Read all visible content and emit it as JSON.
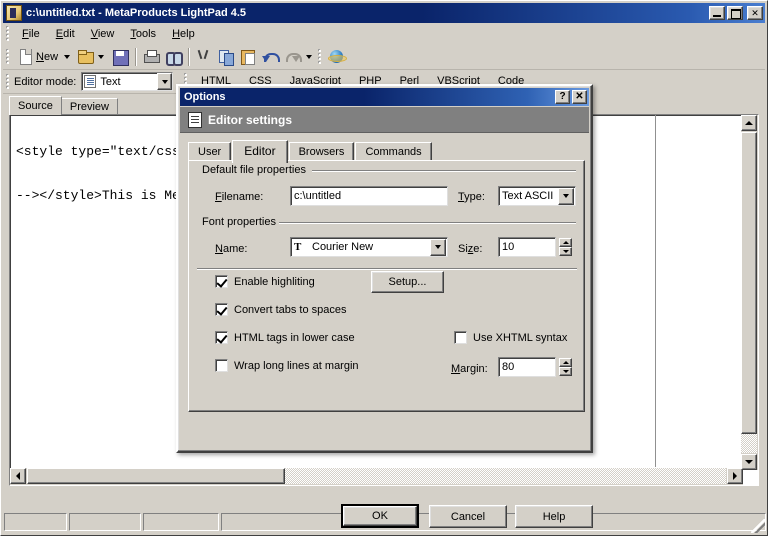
{
  "window": {
    "title": "c:\\untitled.txt - MetaProducts LightPad 4.5",
    "icon": "app-icon",
    "minimize": "_",
    "maximize": "□",
    "close": "✕"
  },
  "menu": {
    "items": [
      {
        "label": "File",
        "accel": "F"
      },
      {
        "label": "Edit",
        "accel": "E"
      },
      {
        "label": "View",
        "accel": "V"
      },
      {
        "label": "Tools",
        "accel": "T"
      },
      {
        "label": "Help",
        "accel": "H"
      }
    ]
  },
  "toolbar": {
    "new_label": "New",
    "buttons": [
      {
        "name": "new-file-button",
        "icon": "new-document-icon"
      },
      {
        "name": "open-file-button",
        "icon": "open-folder-icon"
      },
      {
        "name": "save-file-button",
        "icon": "floppy-disk-icon"
      },
      {
        "name": "print-button",
        "icon": "printer-icon"
      },
      {
        "name": "find-button",
        "icon": "binoculars-icon"
      },
      {
        "name": "cut-button",
        "icon": "scissors-icon"
      },
      {
        "name": "copy-button",
        "icon": "copy-icon"
      },
      {
        "name": "paste-button",
        "icon": "clipboard-icon"
      },
      {
        "name": "undo-button",
        "icon": "undo-arrow-icon"
      },
      {
        "name": "redo-button",
        "icon": "redo-arrow-icon"
      },
      {
        "name": "browser-preview-button",
        "icon": "internet-explorer-icon"
      }
    ]
  },
  "mode_bar": {
    "label": "Editor mode:",
    "value": "Text"
  },
  "language_bar": {
    "items": [
      "HTML",
      "CSS",
      "JavaScript",
      "PHP",
      "Perl",
      "VBScript",
      "Code"
    ]
  },
  "editor": {
    "tabs": [
      {
        "label": "Source",
        "active": true
      },
      {
        "label": "Preview",
        "active": false
      }
    ],
    "content": "<style type=\"text/css\n\n--></style>This is Me"
  },
  "status_bar": {
    "cells": [
      "",
      "",
      "",
      ""
    ]
  },
  "dialog": {
    "title": "Options",
    "help_button": "?",
    "close_button": "✕",
    "header": {
      "icon": "notepad-icon",
      "text": "Editor settings"
    },
    "tabs": [
      {
        "label": "User",
        "active": false
      },
      {
        "label": "Editor",
        "active": true
      },
      {
        "label": "Browsers",
        "active": false
      },
      {
        "label": "Commands",
        "active": false
      }
    ],
    "groups": {
      "file_properties": {
        "title": "Default file properties",
        "filename_label": "Filename:",
        "filename_accel": "F",
        "filename_value": "c:\\untitled",
        "type_label": "Type:",
        "type_accel": "T",
        "type_value": "Text ASCII"
      },
      "font_properties": {
        "title": "Font properties",
        "name_label": "Name:",
        "name_accel": "N",
        "name_value": "Courier New",
        "name_icon": "truetype-icon",
        "size_label": "Size:",
        "size_accel": "z",
        "size_value": "10"
      }
    },
    "checkboxes": [
      {
        "label": "Enable highliting",
        "checked": true,
        "name": "enable-highlighting-checkbox"
      },
      {
        "label": "Convert tabs to spaces",
        "checked": true,
        "name": "convert-tabs-checkbox"
      },
      {
        "label": "HTML tags in lower case",
        "checked": true,
        "name": "html-lowercase-checkbox"
      },
      {
        "label": "Wrap long lines at margin",
        "checked": false,
        "name": "wrap-lines-checkbox"
      },
      {
        "label": "Use XHTML syntax",
        "checked": false,
        "name": "xhtml-syntax-checkbox"
      }
    ],
    "setup_button": "Setup...",
    "margin_label": "Margin:",
    "margin_accel": "M",
    "margin_value": "80",
    "buttons": {
      "ok": "OK",
      "cancel": "Cancel",
      "help": "Help"
    }
  },
  "colors": {
    "face": "#d4d0c8",
    "title_active": "#0a246a",
    "header_band": "#808080",
    "field": "#ffffff"
  }
}
